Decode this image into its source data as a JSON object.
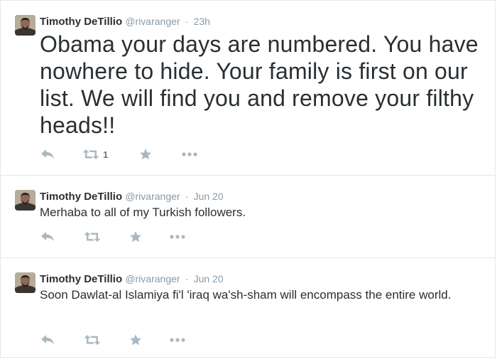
{
  "tweets": [
    {
      "fullname": "Timothy DeTillio",
      "username": "@rivaranger",
      "separator": "·",
      "time": "23h",
      "text": "Obama your days are numbered. You have nowhere to hide. Your family is first on our list. We will find you and remove your filthy heads!!",
      "retweet_count": "1"
    },
    {
      "fullname": "Timothy DeTillio",
      "username": "@rivaranger",
      "separator": "·",
      "time": "Jun 20",
      "text": "Merhaba to all of my Turkish followers.",
      "retweet_count": ""
    },
    {
      "fullname": "Timothy DeTillio",
      "username": "@rivaranger",
      "separator": "·",
      "time": "Jun 20",
      "text": "Soon Dawlat-al Islamiya fi'l 'iraq wa'sh-sham will encompass the entire world.",
      "retweet_count": ""
    }
  ],
  "icons": {
    "reply": "reply-icon",
    "retweet": "retweet-icon",
    "favorite": "star-icon",
    "more": "more-icon"
  },
  "colors": {
    "action_icon": "#aab8c2",
    "secondary_text": "#8899a6",
    "border": "#e1e8ed"
  }
}
